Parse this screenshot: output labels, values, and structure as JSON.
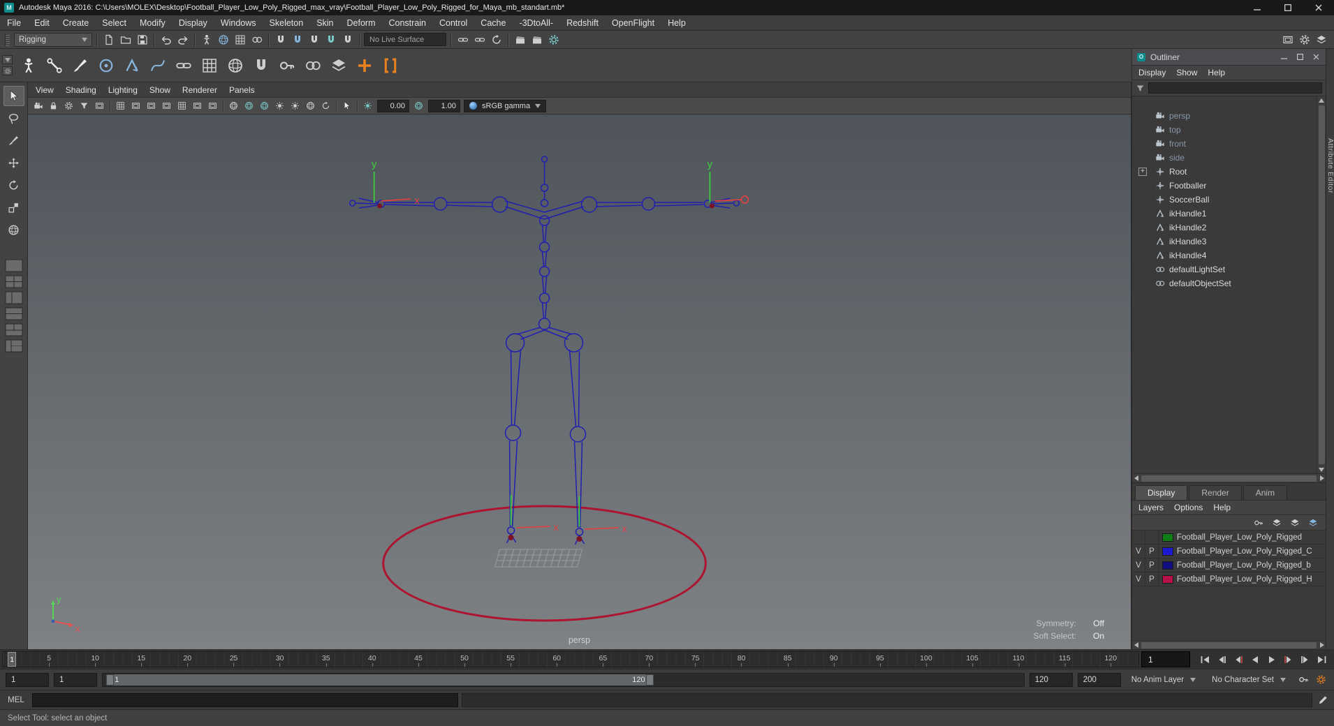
{
  "window": {
    "title": "Autodesk Maya 2016: C:\\Users\\MOLEX\\Desktop\\Football_Player_Low_Poly_Rigged_max_vray\\Football_Player_Low_Poly_Rigged_for_Maya_mb_standart.mb*"
  },
  "menu_bar": {
    "items": [
      "File",
      "Edit",
      "Create",
      "Select",
      "Modify",
      "Display",
      "Windows",
      "Skeleton",
      "Skin",
      "Deform",
      "Constrain",
      "Control",
      "Cache",
      "-3DtoAll-",
      "Redshift",
      "OpenFlight",
      "Help"
    ]
  },
  "status_line": {
    "mode": "Rigging",
    "live_surface": "No Live Surface"
  },
  "panel_menu": {
    "items": [
      "View",
      "Shading",
      "Lighting",
      "Show",
      "Renderer",
      "Panels"
    ]
  },
  "viewport_toolbar": {
    "exposure": "0.00",
    "contrast": "1.00",
    "gamma": "sRGB gamma"
  },
  "viewport": {
    "camera_label": "persp",
    "hud": {
      "symmetry_label": "Symmetry:",
      "symmetry_value": "Off",
      "soft_select_label": "Soft Select:",
      "soft_select_value": "On"
    },
    "axis_labels": {
      "x": "x",
      "y": "y"
    },
    "colors": {
      "bg_top": "#4e545a",
      "bg_bottom": "#7e8285",
      "skeleton": "#2020b0",
      "ground_ring": "#ad1430",
      "axis_x": "#e05555",
      "axis_y": "#58d658"
    }
  },
  "outliner": {
    "title": "Outliner",
    "menus": [
      "Display",
      "Show",
      "Help"
    ],
    "items": [
      {
        "label": "persp",
        "icon": "camera-icon"
      },
      {
        "label": "top",
        "icon": "camera-icon"
      },
      {
        "label": "front",
        "icon": "camera-icon"
      },
      {
        "label": "side",
        "icon": "camera-icon"
      },
      {
        "label": "Root",
        "icon": "transform-icon",
        "expander": "+"
      },
      {
        "label": "Footballer",
        "icon": "transform-icon"
      },
      {
        "label": "SoccerBall",
        "icon": "transform-icon"
      },
      {
        "label": "ikHandle1",
        "icon": "ik-handle-icon"
      },
      {
        "label": "ikHandle2",
        "icon": "ik-handle-icon"
      },
      {
        "label": "ikHandle3",
        "icon": "ik-handle-icon"
      },
      {
        "label": "ikHandle4",
        "icon": "ik-handle-icon"
      },
      {
        "label": "defaultLightSet",
        "icon": "object-set-icon"
      },
      {
        "label": "defaultObjectSet",
        "icon": "object-set-icon"
      }
    ]
  },
  "layer_editor": {
    "tabs": [
      "Display",
      "Render",
      "Anim"
    ],
    "active_tab": "Display",
    "menus": [
      "Layers",
      "Options",
      "Help"
    ],
    "rows": [
      {
        "visible": "",
        "playback": "",
        "color": "#0f7d15",
        "name": "Football_Player_Low_Poly_Rigged"
      },
      {
        "visible": "V",
        "playback": "P",
        "color": "#1a1ad2",
        "name": "Football_Player_Low_Poly_Rigged_C"
      },
      {
        "visible": "V",
        "playback": "P",
        "color": "#10107e",
        "name": "Football_Player_Low_Poly_Rigged_b"
      },
      {
        "visible": "V",
        "playback": "P",
        "color": "#b5124b",
        "name": "Football_Player_Low_Poly_Rigged_H"
      }
    ]
  },
  "right_strip": {
    "tab_label": "Attribute Editor"
  },
  "time_slider": {
    "ticks": [
      "5",
      "10",
      "15",
      "20",
      "25",
      "30",
      "35",
      "40",
      "45",
      "50",
      "55",
      "60",
      "65",
      "70",
      "75",
      "80",
      "85",
      "90",
      "95",
      "100",
      "105",
      "110",
      "115",
      "120"
    ],
    "marker_label": "1",
    "current_frame": "1"
  },
  "range_slider": {
    "anim_start": "1",
    "playback_start": "1",
    "bar_start_label": "1",
    "bar_end_label": "120",
    "playback_end": "120",
    "anim_end": "200"
  },
  "anim_bar": {
    "anim_layer": "No Anim Layer",
    "character_set": "No Character Set"
  },
  "command_line": {
    "label": "MEL",
    "input_value": "",
    "echo_value": ""
  },
  "help_line": {
    "message": "Select Tool: select an object"
  }
}
